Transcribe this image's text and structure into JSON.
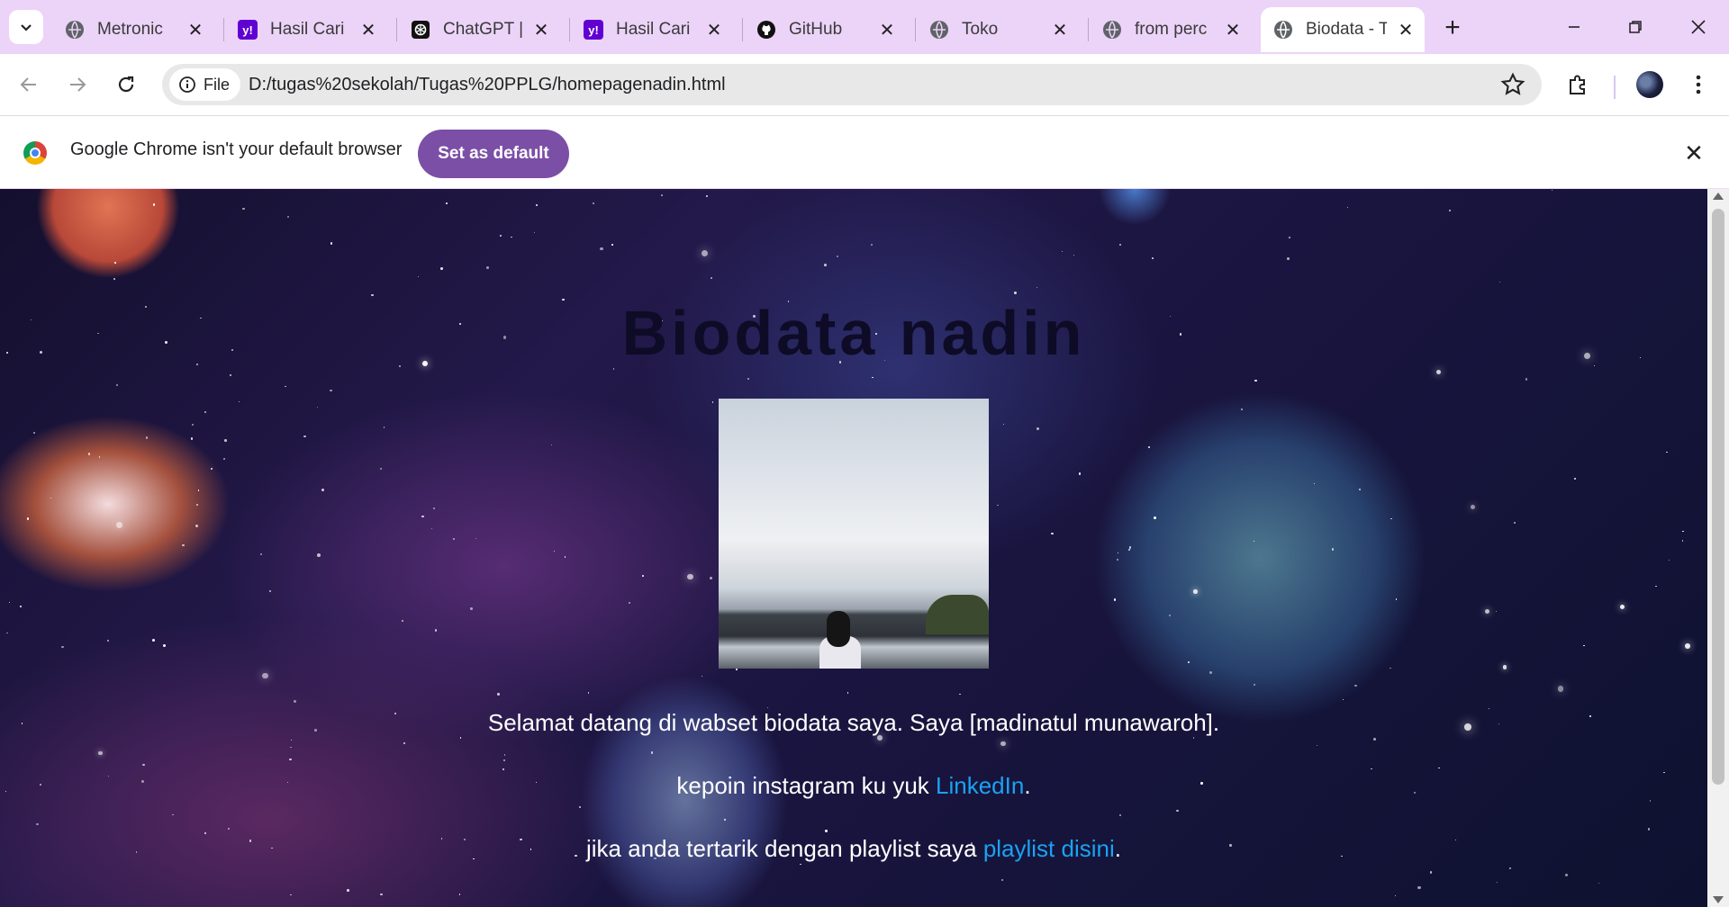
{
  "tabs": [
    {
      "title": "Metronic",
      "favicon": "globe-icon",
      "active": false
    },
    {
      "title": "Hasil Cari",
      "favicon": "yahoo-icon",
      "active": false
    },
    {
      "title": "ChatGPT |",
      "favicon": "openai-icon",
      "active": false
    },
    {
      "title": "Hasil Cari",
      "favicon": "yahoo-icon",
      "active": false
    },
    {
      "title": "GitHub",
      "favicon": "github-icon",
      "active": false
    },
    {
      "title": "Toko",
      "favicon": "globe-icon",
      "active": false
    },
    {
      "title": "from perc",
      "favicon": "globe-icon",
      "active": false
    },
    {
      "title": "Biodata - T",
      "favicon": "globe-icon",
      "active": true
    }
  ],
  "toolbar": {
    "chip_label": "File",
    "url": "D:/tugas%20sekolah/Tugas%20PPLG/homepagenadin.html"
  },
  "infobar": {
    "message": "Google Chrome isn't your default browser",
    "button_label": "Set as default"
  },
  "page": {
    "title": "Biodata nadin",
    "intro": "Selamat datang di wabset biodata saya. Saya [madinatul munawaroh].",
    "instagram_text": "kepoin instagram ku yuk ",
    "instagram_link": "LinkedIn",
    "instagram_after": ".",
    "playlist_text": "jika anda tertarik dengan playlist saya ",
    "playlist_link": "playlist disini",
    "playlist_after": "."
  },
  "colors": {
    "tabstrip": "#ecd3f8",
    "accent_button": "#7b4fa6",
    "link": "#1aa2f2",
    "title": "#0e0b26"
  }
}
